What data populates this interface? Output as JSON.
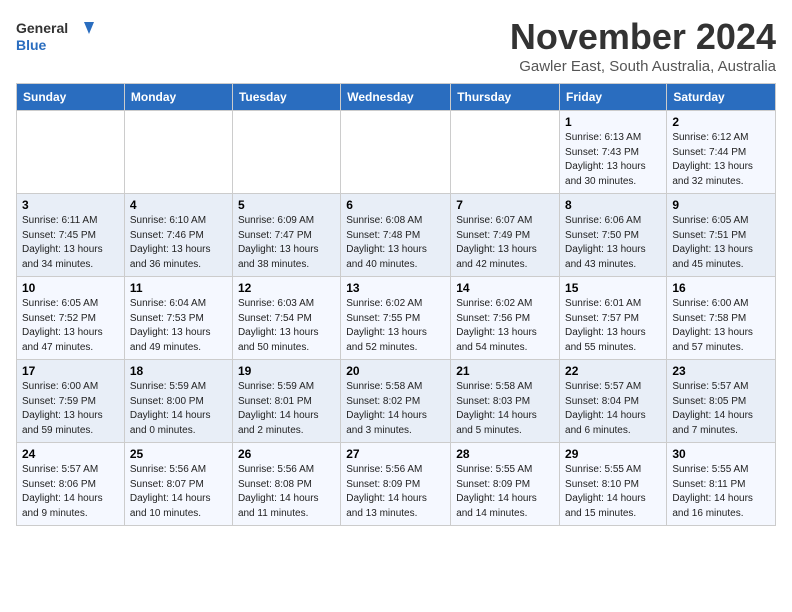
{
  "header": {
    "logo_line1": "General",
    "logo_line2": "Blue",
    "month": "November 2024",
    "location": "Gawler East, South Australia, Australia"
  },
  "days_of_week": [
    "Sunday",
    "Monday",
    "Tuesday",
    "Wednesday",
    "Thursday",
    "Friday",
    "Saturday"
  ],
  "weeks": [
    [
      {
        "day": "",
        "info": ""
      },
      {
        "day": "",
        "info": ""
      },
      {
        "day": "",
        "info": ""
      },
      {
        "day": "",
        "info": ""
      },
      {
        "day": "",
        "info": ""
      },
      {
        "day": "1",
        "info": "Sunrise: 6:13 AM\nSunset: 7:43 PM\nDaylight: 13 hours\nand 30 minutes."
      },
      {
        "day": "2",
        "info": "Sunrise: 6:12 AM\nSunset: 7:44 PM\nDaylight: 13 hours\nand 32 minutes."
      }
    ],
    [
      {
        "day": "3",
        "info": "Sunrise: 6:11 AM\nSunset: 7:45 PM\nDaylight: 13 hours\nand 34 minutes."
      },
      {
        "day": "4",
        "info": "Sunrise: 6:10 AM\nSunset: 7:46 PM\nDaylight: 13 hours\nand 36 minutes."
      },
      {
        "day": "5",
        "info": "Sunrise: 6:09 AM\nSunset: 7:47 PM\nDaylight: 13 hours\nand 38 minutes."
      },
      {
        "day": "6",
        "info": "Sunrise: 6:08 AM\nSunset: 7:48 PM\nDaylight: 13 hours\nand 40 minutes."
      },
      {
        "day": "7",
        "info": "Sunrise: 6:07 AM\nSunset: 7:49 PM\nDaylight: 13 hours\nand 42 minutes."
      },
      {
        "day": "8",
        "info": "Sunrise: 6:06 AM\nSunset: 7:50 PM\nDaylight: 13 hours\nand 43 minutes."
      },
      {
        "day": "9",
        "info": "Sunrise: 6:05 AM\nSunset: 7:51 PM\nDaylight: 13 hours\nand 45 minutes."
      }
    ],
    [
      {
        "day": "10",
        "info": "Sunrise: 6:05 AM\nSunset: 7:52 PM\nDaylight: 13 hours\nand 47 minutes."
      },
      {
        "day": "11",
        "info": "Sunrise: 6:04 AM\nSunset: 7:53 PM\nDaylight: 13 hours\nand 49 minutes."
      },
      {
        "day": "12",
        "info": "Sunrise: 6:03 AM\nSunset: 7:54 PM\nDaylight: 13 hours\nand 50 minutes."
      },
      {
        "day": "13",
        "info": "Sunrise: 6:02 AM\nSunset: 7:55 PM\nDaylight: 13 hours\nand 52 minutes."
      },
      {
        "day": "14",
        "info": "Sunrise: 6:02 AM\nSunset: 7:56 PM\nDaylight: 13 hours\nand 54 minutes."
      },
      {
        "day": "15",
        "info": "Sunrise: 6:01 AM\nSunset: 7:57 PM\nDaylight: 13 hours\nand 55 minutes."
      },
      {
        "day": "16",
        "info": "Sunrise: 6:00 AM\nSunset: 7:58 PM\nDaylight: 13 hours\nand 57 minutes."
      }
    ],
    [
      {
        "day": "17",
        "info": "Sunrise: 6:00 AM\nSunset: 7:59 PM\nDaylight: 13 hours\nand 59 minutes."
      },
      {
        "day": "18",
        "info": "Sunrise: 5:59 AM\nSunset: 8:00 PM\nDaylight: 14 hours\nand 0 minutes."
      },
      {
        "day": "19",
        "info": "Sunrise: 5:59 AM\nSunset: 8:01 PM\nDaylight: 14 hours\nand 2 minutes."
      },
      {
        "day": "20",
        "info": "Sunrise: 5:58 AM\nSunset: 8:02 PM\nDaylight: 14 hours\nand 3 minutes."
      },
      {
        "day": "21",
        "info": "Sunrise: 5:58 AM\nSunset: 8:03 PM\nDaylight: 14 hours\nand 5 minutes."
      },
      {
        "day": "22",
        "info": "Sunrise: 5:57 AM\nSunset: 8:04 PM\nDaylight: 14 hours\nand 6 minutes."
      },
      {
        "day": "23",
        "info": "Sunrise: 5:57 AM\nSunset: 8:05 PM\nDaylight: 14 hours\nand 7 minutes."
      }
    ],
    [
      {
        "day": "24",
        "info": "Sunrise: 5:57 AM\nSunset: 8:06 PM\nDaylight: 14 hours\nand 9 minutes."
      },
      {
        "day": "25",
        "info": "Sunrise: 5:56 AM\nSunset: 8:07 PM\nDaylight: 14 hours\nand 10 minutes."
      },
      {
        "day": "26",
        "info": "Sunrise: 5:56 AM\nSunset: 8:08 PM\nDaylight: 14 hours\nand 11 minutes."
      },
      {
        "day": "27",
        "info": "Sunrise: 5:56 AM\nSunset: 8:09 PM\nDaylight: 14 hours\nand 13 minutes."
      },
      {
        "day": "28",
        "info": "Sunrise: 5:55 AM\nSunset: 8:09 PM\nDaylight: 14 hours\nand 14 minutes."
      },
      {
        "day": "29",
        "info": "Sunrise: 5:55 AM\nSunset: 8:10 PM\nDaylight: 14 hours\nand 15 minutes."
      },
      {
        "day": "30",
        "info": "Sunrise: 5:55 AM\nSunset: 8:11 PM\nDaylight: 14 hours\nand 16 minutes."
      }
    ]
  ]
}
